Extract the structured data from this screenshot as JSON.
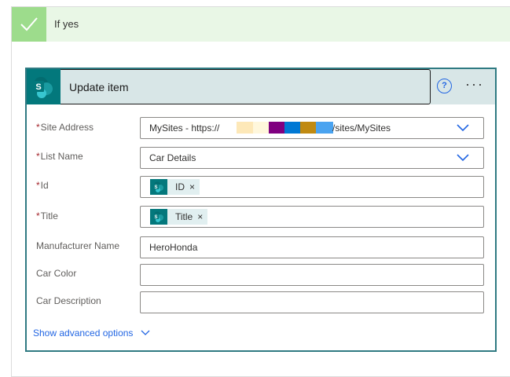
{
  "condition": {
    "label": "If yes"
  },
  "card": {
    "title": "Update item",
    "help_glyph": "?",
    "more_glyph": "···"
  },
  "fields": {
    "site_address": {
      "label": "Site Address",
      "required": "*",
      "value_prefix": "MySites - https://",
      "value_suffix": "/sites/MySites"
    },
    "list_name": {
      "label": "List Name",
      "required": "*",
      "value": "Car Details"
    },
    "id": {
      "label": "Id",
      "required": "*",
      "token": "ID",
      "remove": "×"
    },
    "title": {
      "label": "Title",
      "required": "*",
      "token": "Title",
      "remove": "×"
    },
    "manufacturer": {
      "label": "Manufacturer Name",
      "value": "HeroHonda"
    },
    "car_color": {
      "label": "Car Color",
      "value": ""
    },
    "car_description": {
      "label": "Car Description",
      "value": ""
    }
  },
  "advanced": {
    "label": "Show advanced options"
  },
  "colors": {
    "accent": "#03787c",
    "link": "#2266e3",
    "success": "#9ddc8c",
    "success_bg": "#e9f7e6",
    "required": "#a4262c"
  },
  "icons": [
    "check-icon",
    "sharepoint-icon",
    "help-icon",
    "more-icon",
    "chevron-down-icon",
    "remove-token-icon"
  ]
}
